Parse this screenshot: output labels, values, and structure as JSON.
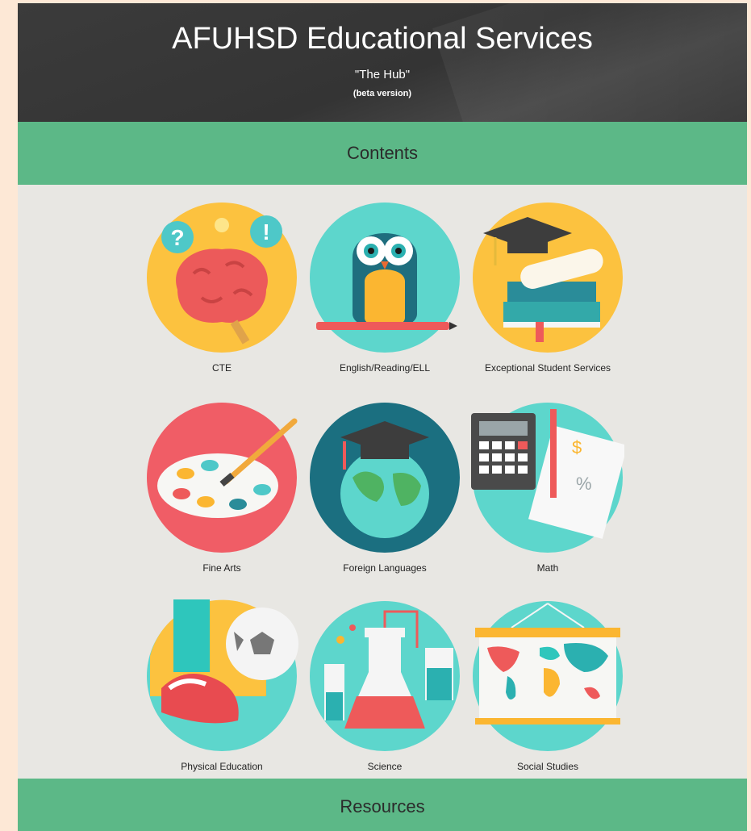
{
  "header": {
    "title": "AFUHSD Educational Services",
    "subtitle": "\"The Hub\"",
    "beta": "(beta version)"
  },
  "sections": {
    "contents": "Contents",
    "resources": "Resources"
  },
  "tiles": [
    {
      "label": "CTE",
      "icon": "brain-icon"
    },
    {
      "label": "English/Reading/ELL",
      "icon": "owl-icon"
    },
    {
      "label": "Exceptional Student Services",
      "icon": "graduation-books-icon"
    },
    {
      "label": "Fine Arts",
      "icon": "paint-palette-icon"
    },
    {
      "label": "Foreign Languages",
      "icon": "globe-graduation-cap-icon"
    },
    {
      "label": "Math",
      "icon": "calculator-icon"
    },
    {
      "label": "Physical Education",
      "icon": "soccer-cleat-icon"
    },
    {
      "label": "Science",
      "icon": "lab-flask-icon"
    },
    {
      "label": "Social Studies",
      "icon": "world-map-icon"
    }
  ],
  "colors": {
    "band": "#5cb887",
    "header": "#363636",
    "background": "#e8e7e3",
    "outer": "#fde8d6"
  }
}
